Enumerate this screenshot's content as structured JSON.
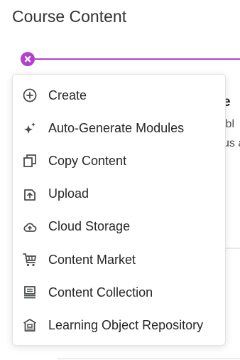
{
  "page": {
    "title": "Course Content"
  },
  "background": {
    "heading_fragment": "e",
    "line1_fragment": "ibl",
    "line2_fragment": "us a"
  },
  "menu": {
    "items": [
      {
        "label": "Create",
        "icon": "plus-circle-icon"
      },
      {
        "label": "Auto-Generate Modules",
        "icon": "sparkle-icon"
      },
      {
        "label": "Copy Content",
        "icon": "copy-icon"
      },
      {
        "label": "Upload",
        "icon": "upload-icon"
      },
      {
        "label": "Cloud Storage",
        "icon": "cloud-upload-icon"
      },
      {
        "label": "Content Market",
        "icon": "cart-icon"
      },
      {
        "label": "Content Collection",
        "icon": "collection-icon"
      },
      {
        "label": "Learning Object Repository",
        "icon": "repository-icon"
      }
    ]
  },
  "colors": {
    "accent": "#b43fce",
    "icon": "#494c4e",
    "text": "#262626"
  }
}
